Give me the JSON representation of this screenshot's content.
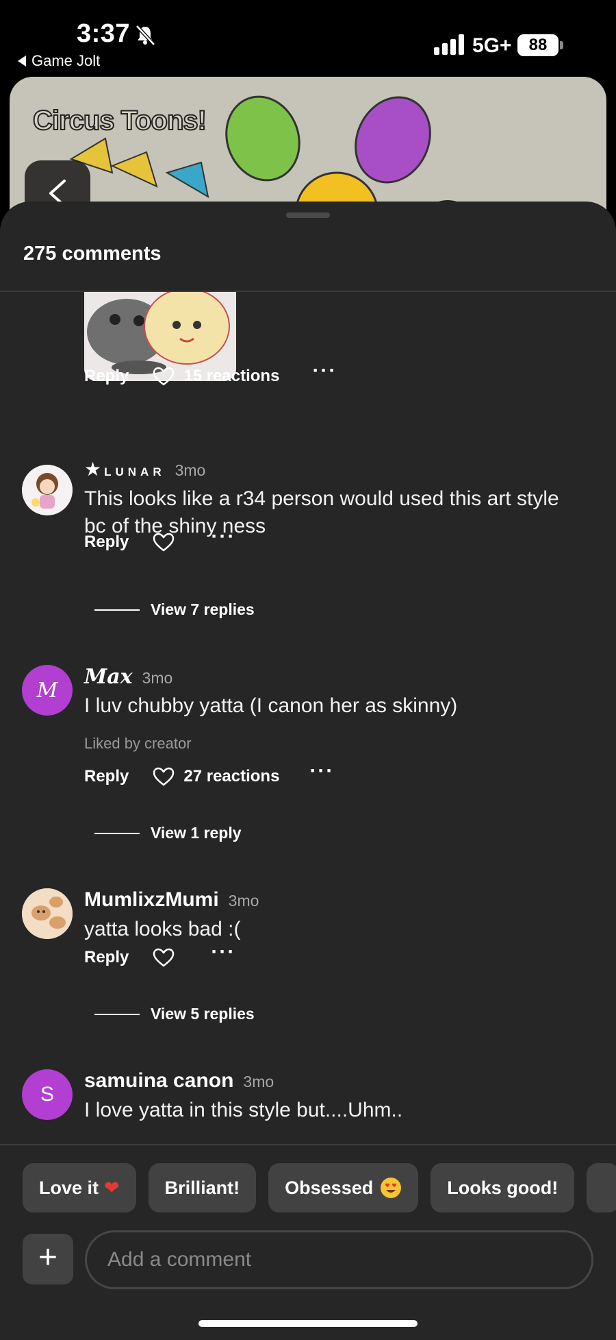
{
  "status_bar": {
    "time": "3:37",
    "back_app": "Game Jolt",
    "network": "5G+",
    "battery": "88"
  },
  "banner": {
    "title": "Circus Toons!"
  },
  "sheet": {
    "comment_count": "275 comments"
  },
  "first_actions": {
    "reply": "Reply",
    "reactions": "15 reactions",
    "more": "···"
  },
  "comments": [
    {
      "username": "LUNAR",
      "time": "3mo",
      "text": "This looks like a r34 person would used this art style bc of the shiny ness",
      "reply": "Reply",
      "reactions": "",
      "more": "···",
      "view_replies": "View 7 replies"
    },
    {
      "username": "Max",
      "avatar_letter": "M",
      "avatar_color": "#b23fd1",
      "time": "3mo",
      "text": "I luv chubby yatta (I canon her as skinny)",
      "liked_by": "Liked by creator",
      "reply": "Reply",
      "reactions": "27 reactions",
      "more": "···",
      "view_replies": "View 1 reply"
    },
    {
      "username": "MumlixzMumi",
      "time": "3mo",
      "text": "yatta looks bad :(",
      "reply": "Reply",
      "reactions": "",
      "more": "···",
      "view_replies": "View 5 replies"
    },
    {
      "username": "samuina canon",
      "avatar_letter": "S",
      "avatar_color": "#b23fd1",
      "time": "3mo",
      "text": "I love yatta in this style but....Uhm.."
    }
  ],
  "quick_reactions": [
    {
      "label": "Love it",
      "emoji": "❤️"
    },
    {
      "label": "Brilliant!",
      "emoji": ""
    },
    {
      "label": "Obsessed",
      "emoji": "😍"
    },
    {
      "label": "Looks good!",
      "emoji": ""
    }
  ],
  "composer": {
    "add_label": "+",
    "placeholder": "Add a comment"
  },
  "icons": {
    "heart": "heart-icon",
    "bell": "bell-slash-icon",
    "back": "chevron-left-icon"
  }
}
